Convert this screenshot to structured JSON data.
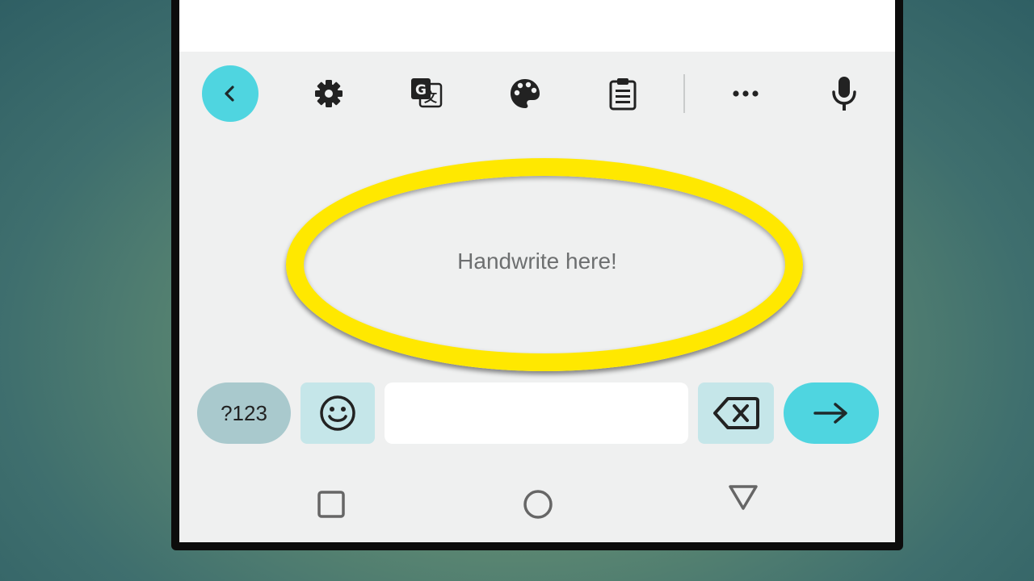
{
  "handwriting": {
    "placeholder": "Handwrite here!"
  },
  "toolbar": {
    "items": [
      {
        "name": "back",
        "icon": "chevron-left-icon"
      },
      {
        "name": "settings",
        "icon": "gear-icon"
      },
      {
        "name": "translate",
        "icon": "translate-icon"
      },
      {
        "name": "theme",
        "icon": "palette-icon"
      },
      {
        "name": "clipboard",
        "icon": "clipboard-icon"
      },
      {
        "name": "more",
        "icon": "more-horizontal-icon"
      },
      {
        "name": "voice",
        "icon": "microphone-icon"
      }
    ]
  },
  "keys": {
    "symbols_label": "?123",
    "emoji_icon": "smiley-icon",
    "space_label": "",
    "delete_icon": "backspace-icon",
    "enter_icon": "arrow-right-icon"
  },
  "navbar": {
    "items": [
      "recents-square-icon",
      "home-circle-icon",
      "back-triangle-icon"
    ]
  },
  "colors": {
    "accent": "#4fd5e0",
    "highlight_ring": "#ffe800",
    "keyboard_bg": "#eff0f0",
    "symbols_key": "#a9c9cd",
    "secondary_key": "#c5e6e9"
  }
}
